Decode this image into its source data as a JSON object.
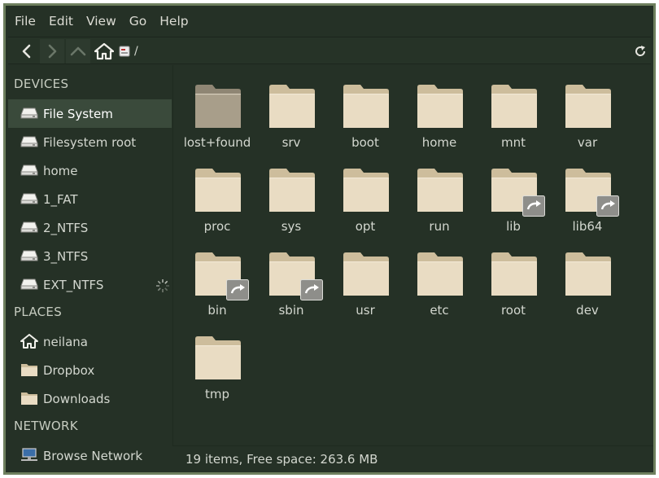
{
  "menu": [
    "File",
    "Edit",
    "View",
    "Go",
    "Help"
  ],
  "toolbar": {
    "path": "/"
  },
  "sidebar": {
    "devices_header": "DEVICES",
    "devices": [
      {
        "label": "File System",
        "icon": "drive-icon",
        "selected": true
      },
      {
        "label": "Filesystem root",
        "icon": "drive-icon"
      },
      {
        "label": "home",
        "icon": "drive-icon"
      },
      {
        "label": "1_FAT",
        "icon": "drive-icon"
      },
      {
        "label": "2_NTFS",
        "icon": "drive-icon"
      },
      {
        "label": "3_NTFS",
        "icon": "drive-icon"
      },
      {
        "label": "EXT_NTFS",
        "icon": "drive-icon",
        "loading": true
      }
    ],
    "places_header": "PLACES",
    "places": [
      {
        "label": "neilana",
        "icon": "home-icon"
      },
      {
        "label": "Dropbox",
        "icon": "folder-icon"
      },
      {
        "label": "Downloads",
        "icon": "folder-icon"
      }
    ],
    "network_header": "NETWORK",
    "network": [
      {
        "label": "Browse Network",
        "icon": "network-icon"
      }
    ]
  },
  "files": [
    {
      "name": "lost+found",
      "locked": true
    },
    {
      "name": "srv"
    },
    {
      "name": "boot"
    },
    {
      "name": "home"
    },
    {
      "name": "mnt"
    },
    {
      "name": "var"
    },
    {
      "name": "proc"
    },
    {
      "name": "sys"
    },
    {
      "name": "opt"
    },
    {
      "name": "run"
    },
    {
      "name": "lib",
      "symlink": true
    },
    {
      "name": "lib64",
      "symlink": true
    },
    {
      "name": "bin",
      "symlink": true
    },
    {
      "name": "sbin",
      "symlink": true
    },
    {
      "name": "usr"
    },
    {
      "name": "etc"
    },
    {
      "name": "root"
    },
    {
      "name": "dev"
    },
    {
      "name": "tmp"
    }
  ],
  "status": {
    "text": "19 items, Free space: 263.6 MB"
  },
  "colors": {
    "folder": "#e9dcc3",
    "folder_back": "#cdbd9c",
    "folder_locked": "#a89e8a",
    "selection": "#3a4a3b"
  }
}
